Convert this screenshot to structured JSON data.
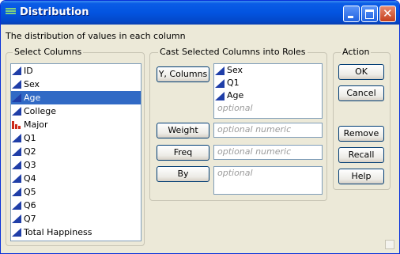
{
  "window": {
    "title": "Distribution"
  },
  "description": "The distribution of values in each column",
  "select_columns": {
    "label": "Select Columns",
    "items": [
      {
        "label": "ID",
        "icon": "continuous-icon",
        "selected": false
      },
      {
        "label": "Sex",
        "icon": "continuous-icon",
        "selected": false
      },
      {
        "label": "Age",
        "icon": "continuous-icon",
        "selected": true
      },
      {
        "label": "College",
        "icon": "continuous-icon",
        "selected": false
      },
      {
        "label": "Major",
        "icon": "nominal-icon",
        "selected": false
      },
      {
        "label": "Q1",
        "icon": "continuous-icon",
        "selected": false
      },
      {
        "label": "Q2",
        "icon": "continuous-icon",
        "selected": false
      },
      {
        "label": "Q3",
        "icon": "continuous-icon",
        "selected": false
      },
      {
        "label": "Q4",
        "icon": "continuous-icon",
        "selected": false
      },
      {
        "label": "Q5",
        "icon": "continuous-icon",
        "selected": false
      },
      {
        "label": "Q6",
        "icon": "continuous-icon",
        "selected": false
      },
      {
        "label": "Q7",
        "icon": "continuous-icon",
        "selected": false
      },
      {
        "label": "Total Happiness",
        "icon": "continuous-icon",
        "selected": false
      }
    ]
  },
  "cast_roles": {
    "label": "Cast Selected Columns into Roles",
    "y_columns": {
      "button": "Y, Columns",
      "items": [
        "Sex",
        "Q1",
        "Age"
      ],
      "placeholder": "optional"
    },
    "weight": {
      "button": "Weight",
      "placeholder": "optional numeric"
    },
    "freq": {
      "button": "Freq",
      "placeholder": "optional numeric"
    },
    "by": {
      "button": "By",
      "placeholder": "optional"
    }
  },
  "action": {
    "label": "Action",
    "ok": "OK",
    "cancel": "Cancel",
    "remove": "Remove",
    "recall": "Recall",
    "help": "Help"
  },
  "colors": {
    "selection": "#316ac5",
    "titlebar": "#0354e0",
    "continuous": "#1f3ea8",
    "nominal": "#cc2a1a"
  }
}
